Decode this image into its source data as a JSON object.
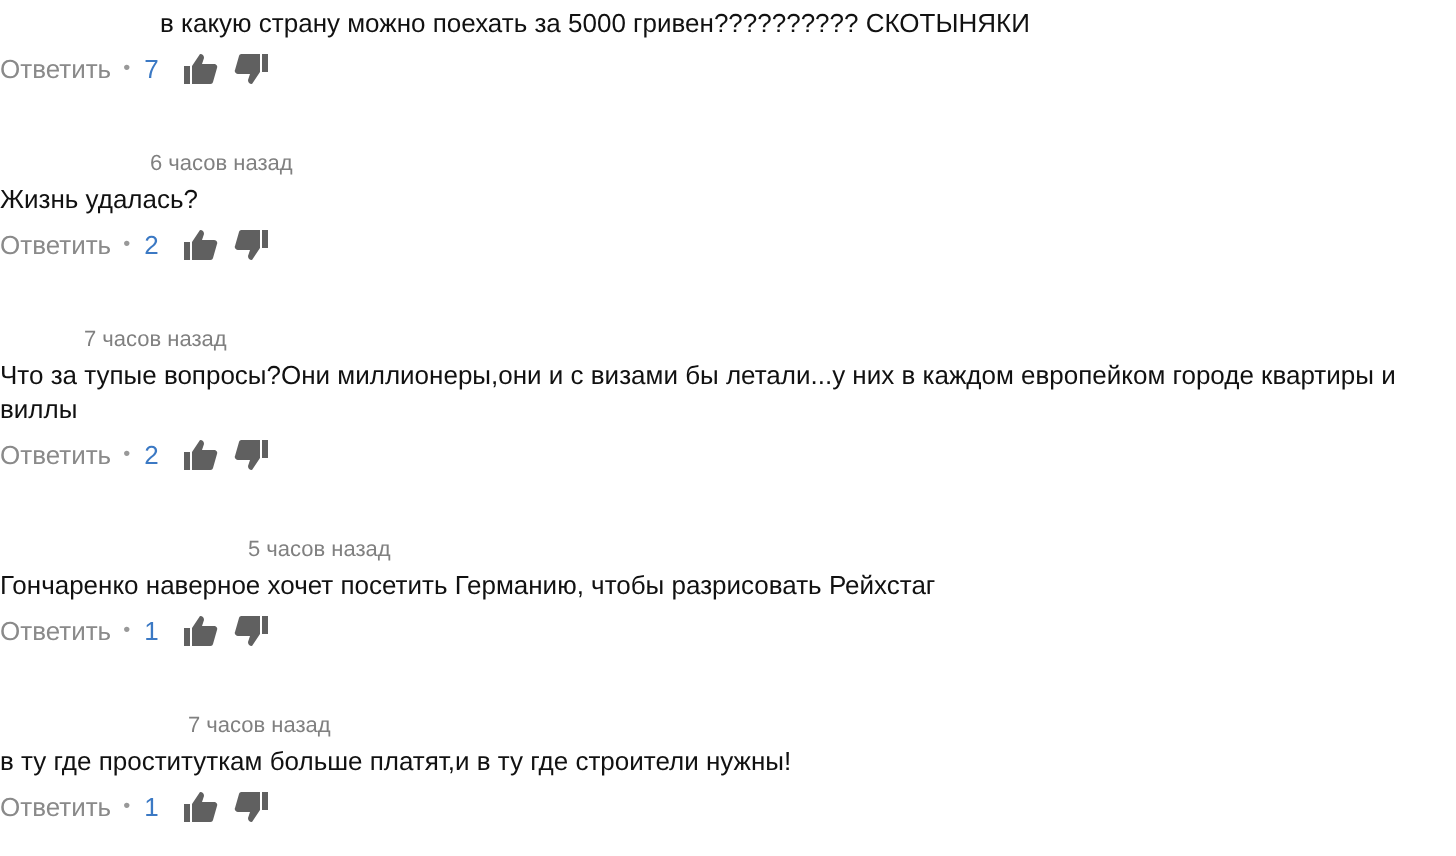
{
  "comments": [
    {
      "text": "в какую страну можно поехать за 5000 гривен?????????? СКОТЫНЯКИ",
      "reply": "Ответить",
      "separator": "•",
      "likes": "7"
    },
    {
      "time": "6 часов назад",
      "text": "Жизнь удалась?",
      "reply": "Ответить",
      "separator": "•",
      "likes": "2"
    },
    {
      "time": "7 часов назад",
      "text": "Что за тупые вопросы?Они миллионеры,они и с визами бы летали...у них в каждом европейком городе квартиры и виллы",
      "reply": "Ответить",
      "separator": "•",
      "likes": "2"
    },
    {
      "time": "5 часов назад",
      "text": "Гончаренко наверное хочет посетить Германию, чтобы разрисовать Рейхстаг",
      "reply": "Ответить",
      "separator": "•",
      "likes": "1"
    },
    {
      "time": "7 часов назад",
      "text": "в ту где проституткам больше платят,и в ту где строители нужны!",
      "reply": "Ответить",
      "separator": "•",
      "likes": "1"
    }
  ]
}
